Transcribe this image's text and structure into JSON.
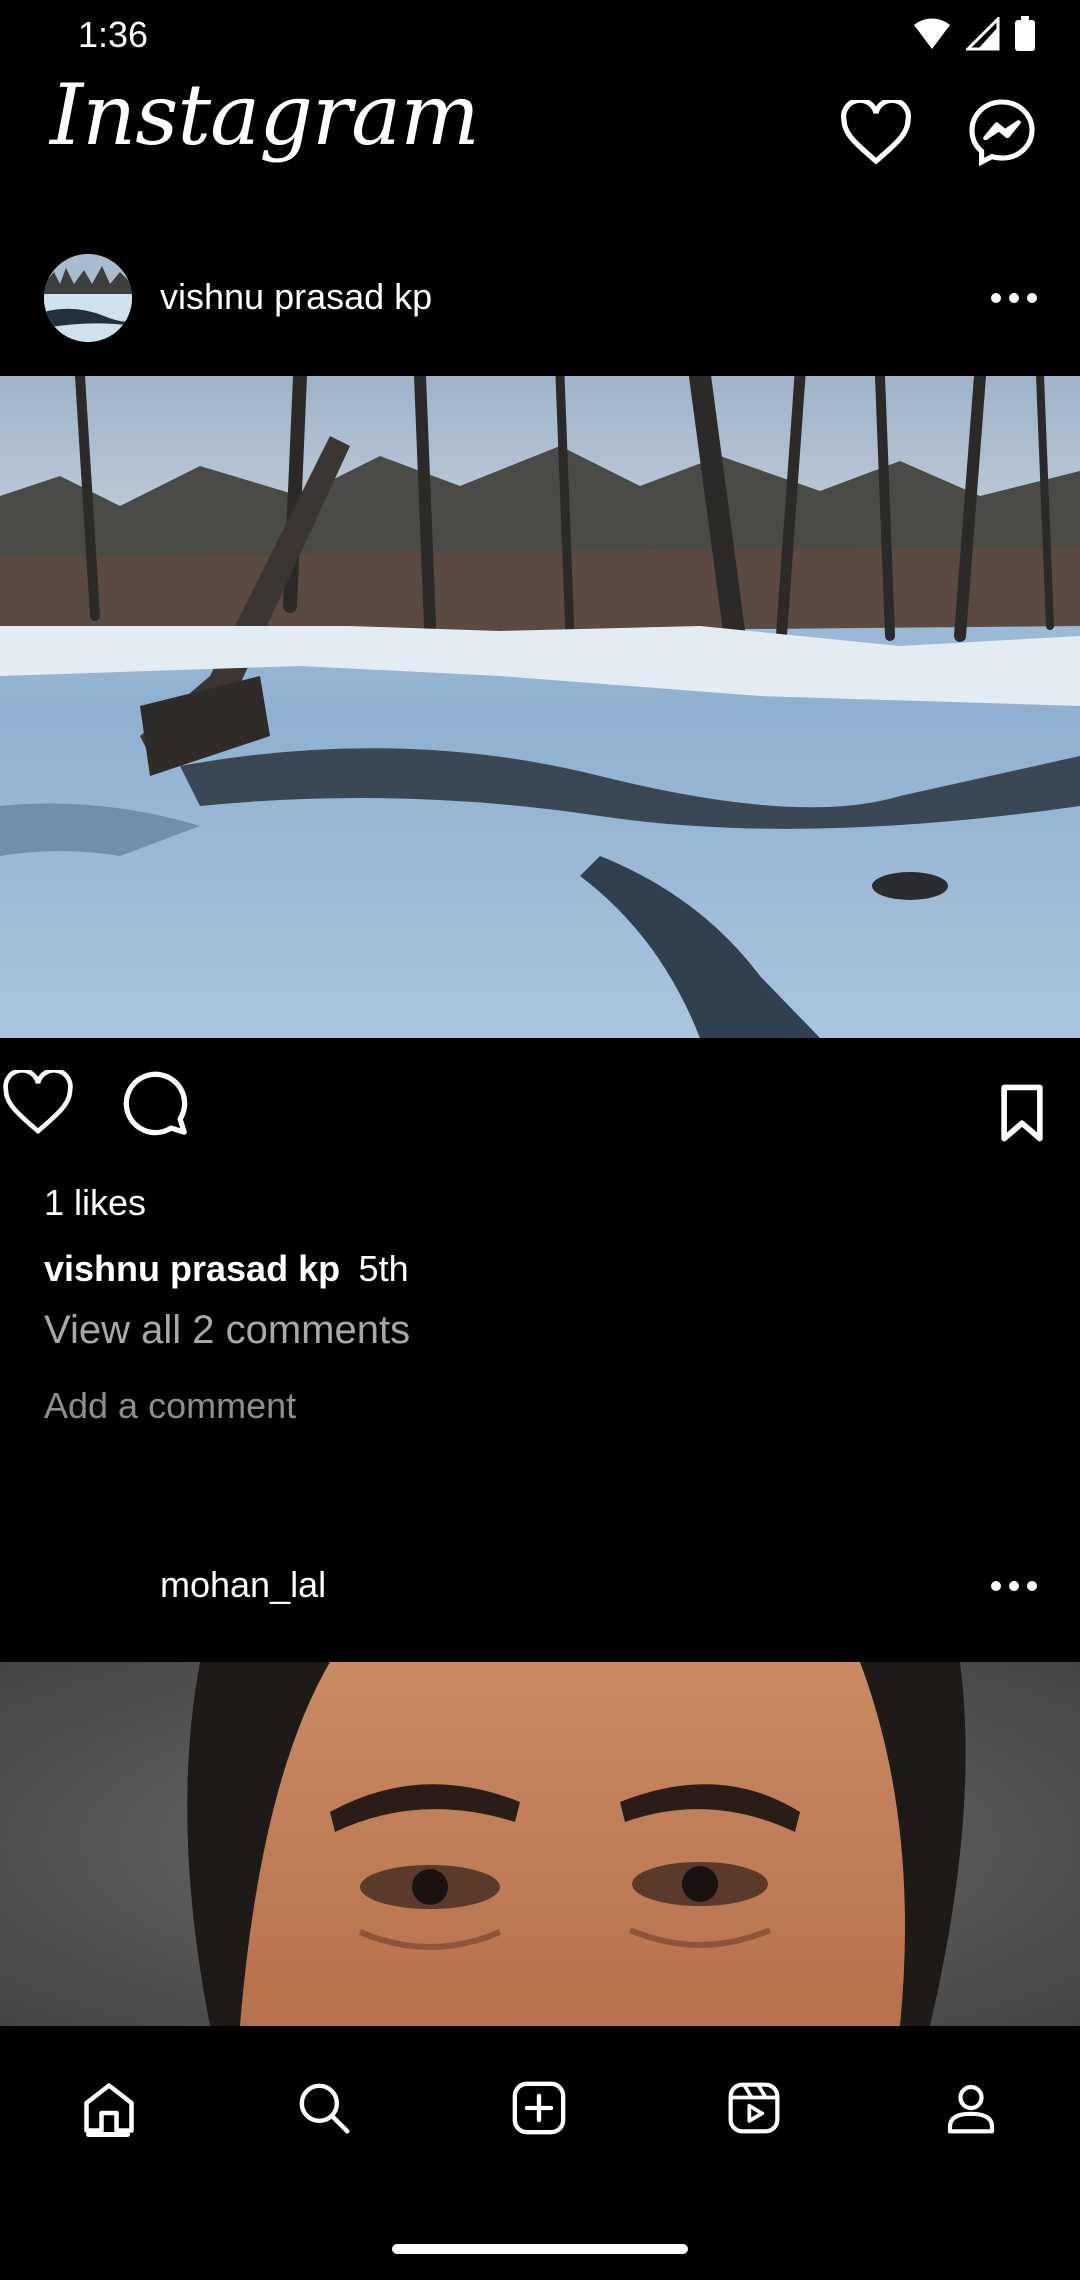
{
  "status_bar": {
    "time": "1:36"
  },
  "app": {
    "brand": "Instagram"
  },
  "posts": [
    {
      "username": "vishnu prasad kp",
      "likes": "1 likes",
      "caption_user": "vishnu prasad kp",
      "caption_text": "5th",
      "view_comments": "View all 2 comments",
      "add_comment_placeholder": "Add a comment"
    },
    {
      "username": "mohan_lal"
    }
  ],
  "icons": {
    "header": [
      "heart-icon",
      "messenger-icon"
    ],
    "post_actions": [
      "heart-icon",
      "comment-icon",
      "bookmark-icon"
    ],
    "nav": [
      "home-icon",
      "search-icon",
      "add-post-icon",
      "reels-icon",
      "profile-icon"
    ]
  },
  "colors": {
    "background": "#000000",
    "text": "#ffffff",
    "muted": "#a8a8a8"
  }
}
